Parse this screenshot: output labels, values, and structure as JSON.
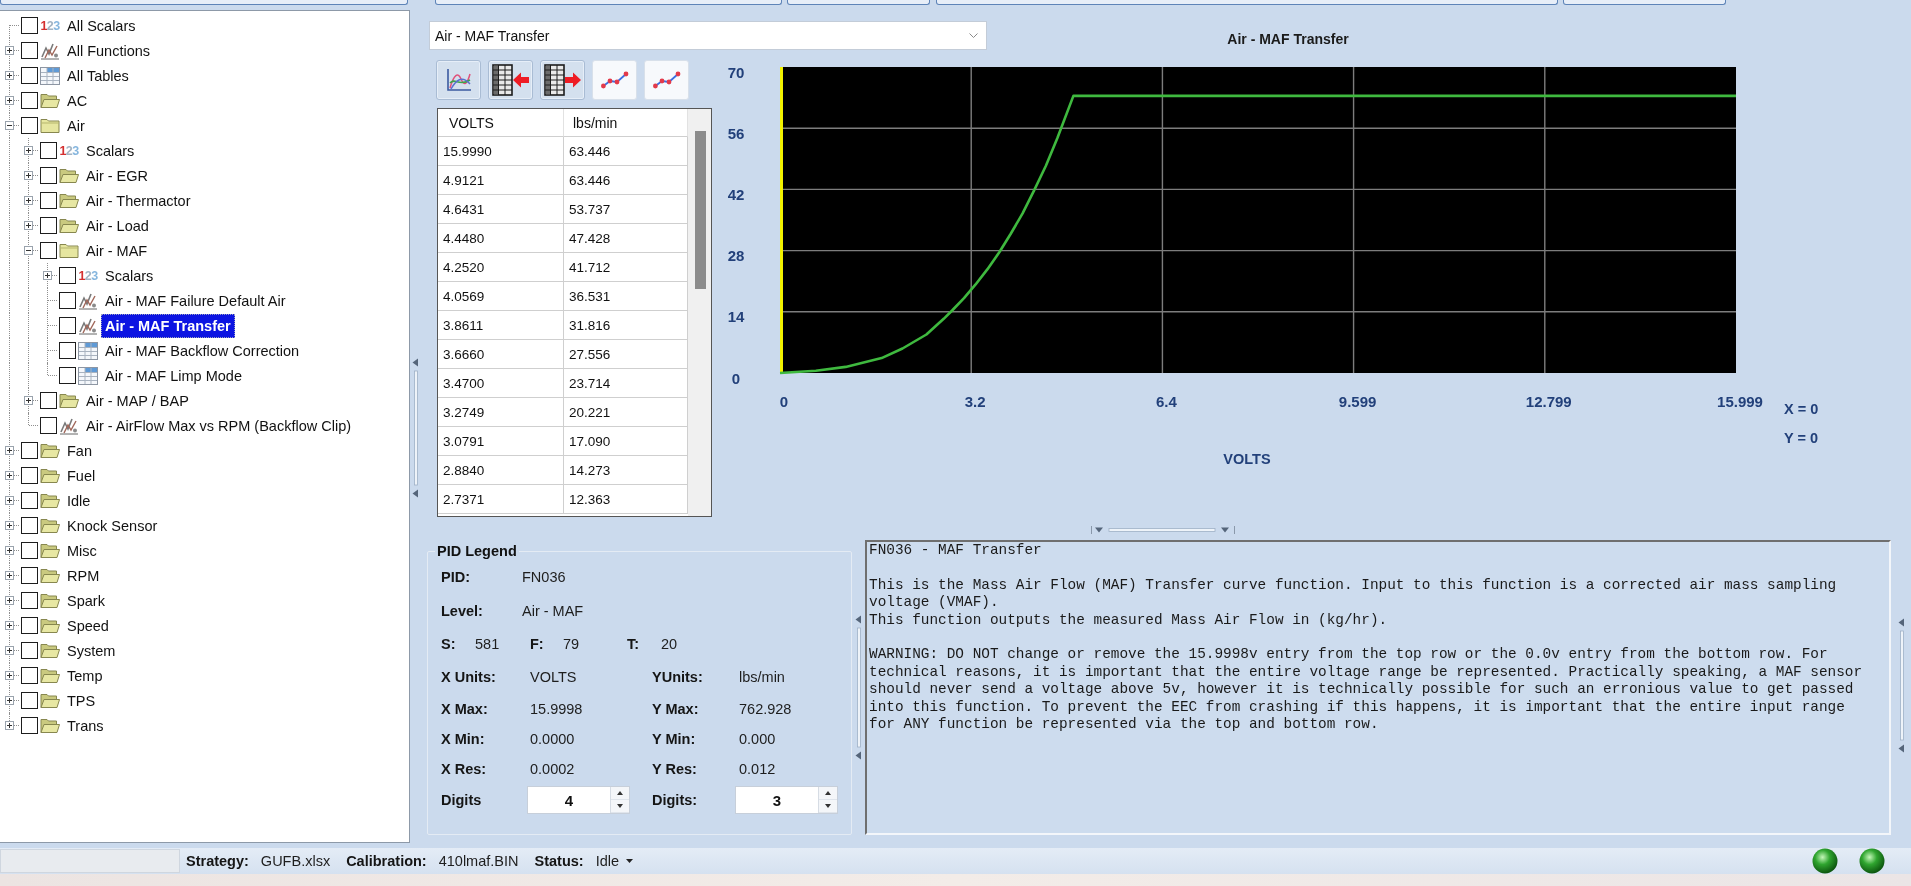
{
  "tree": [
    {
      "label": "All Scalars",
      "kind": "scalars",
      "icon_glyph": "123",
      "checked": false,
      "selected": false
    },
    {
      "label": "All Functions",
      "kind": "function",
      "checked": false,
      "selected": false,
      "expanded": false
    },
    {
      "label": "All Tables",
      "kind": "table",
      "checked": false,
      "selected": false,
      "expanded": false
    },
    {
      "label": "AC",
      "kind": "folder",
      "checked": false,
      "selected": false,
      "expanded": false
    },
    {
      "label": "Air",
      "kind": "folder",
      "checked": false,
      "selected": false,
      "expanded": true,
      "children": [
        {
          "label": "Scalars",
          "kind": "scalars",
          "icon_glyph": "123",
          "checked": false,
          "selected": false,
          "expanded": false
        },
        {
          "label": "Air - EGR",
          "kind": "folder",
          "checked": false,
          "selected": false,
          "expanded": false
        },
        {
          "label": "Air - Thermactor",
          "kind": "folder",
          "checked": false,
          "selected": false,
          "expanded": false
        },
        {
          "label": "Air - Load",
          "kind": "folder",
          "checked": false,
          "selected": false,
          "expanded": false
        },
        {
          "label": "Air - MAF",
          "kind": "folder",
          "checked": false,
          "selected": false,
          "expanded": true,
          "children": [
            {
              "label": "Scalars",
              "kind": "scalars",
              "icon_glyph": "123",
              "checked": false,
              "selected": false,
              "expanded": false
            },
            {
              "label": "Air - MAF Failure Default Air",
              "kind": "function",
              "checked": false,
              "selected": false
            },
            {
              "label": "Air - MAF Transfer",
              "kind": "function",
              "checked": false,
              "selected": true
            },
            {
              "label": "Air - MAF Backflow Correction",
              "kind": "table",
              "checked": false,
              "selected": false
            },
            {
              "label": "Air - MAF Limp Mode",
              "kind": "table",
              "checked": false,
              "selected": false
            }
          ]
        },
        {
          "label": "Air - MAP / BAP",
          "kind": "folder",
          "checked": false,
          "selected": false,
          "expanded": false
        },
        {
          "label": "Air - AirFlow Max vs RPM (Backflow Clip)",
          "kind": "function",
          "checked": false,
          "selected": false
        }
      ]
    },
    {
      "label": "Fan",
      "kind": "folder",
      "checked": false,
      "selected": false,
      "expanded": false
    },
    {
      "label": "Fuel",
      "kind": "folder",
      "checked": false,
      "selected": false,
      "expanded": false
    },
    {
      "label": "Idle",
      "kind": "folder",
      "checked": false,
      "selected": false,
      "expanded": false
    },
    {
      "label": "Knock Sensor",
      "kind": "folder",
      "checked": false,
      "selected": false,
      "expanded": false
    },
    {
      "label": "Misc",
      "kind": "folder",
      "checked": false,
      "selected": false,
      "expanded": false
    },
    {
      "label": "RPM",
      "kind": "folder",
      "checked": false,
      "selected": false,
      "expanded": false
    },
    {
      "label": "Spark",
      "kind": "folder",
      "checked": false,
      "selected": false,
      "expanded": false
    },
    {
      "label": "Speed",
      "kind": "folder",
      "checked": false,
      "selected": false,
      "expanded": false
    },
    {
      "label": "System",
      "kind": "folder",
      "checked": false,
      "selected": false,
      "expanded": false
    },
    {
      "label": "Temp",
      "kind": "folder",
      "checked": false,
      "selected": false,
      "expanded": false
    },
    {
      "label": "TPS",
      "kind": "folder",
      "checked": false,
      "selected": false,
      "expanded": false
    },
    {
      "label": "Trans",
      "kind": "folder",
      "checked": false,
      "selected": false,
      "expanded": false
    }
  ],
  "selector": {
    "value": "Air - MAF Transfer"
  },
  "toolbar": [
    {
      "kind": "chart",
      "pressed": true
    },
    {
      "kind": "table-left",
      "pressed": true
    },
    {
      "kind": "table-right",
      "pressed": true
    },
    {
      "kind": "points",
      "pressed": false
    },
    {
      "kind": "points",
      "pressed": false
    }
  ],
  "grid": {
    "columns": [
      "VOLTS",
      "lbs/min"
    ],
    "rows": [
      [
        "15.9990",
        "63.446"
      ],
      [
        "4.9121",
        "63.446"
      ],
      [
        "4.6431",
        "53.737"
      ],
      [
        "4.4480",
        "47.428"
      ],
      [
        "4.2520",
        "41.712"
      ],
      [
        "4.0569",
        "36.531"
      ],
      [
        "3.8611",
        "31.816"
      ],
      [
        "3.6660",
        "27.556"
      ],
      [
        "3.4700",
        "23.714"
      ],
      [
        "3.2749",
        "20.221"
      ],
      [
        "3.0791",
        "17.090"
      ],
      [
        "2.8840",
        "14.273"
      ],
      [
        "2.7371",
        "12.363"
      ]
    ]
  },
  "chart": {
    "chart_data": {
      "type": "line",
      "title": "Air - MAF Transfer",
      "xlabel": "VOLTS",
      "x": [
        0,
        0.6,
        1.1,
        1.7,
        2.05,
        2.45,
        2.74,
        2.88,
        3.08,
        3.27,
        3.47,
        3.67,
        3.86,
        4.06,
        4.25,
        4.45,
        4.64,
        4.91,
        15.999
      ],
      "series": [
        {
          "color": "#3fb93f",
          "values": [
            0,
            0.5,
            1.4,
            3.4,
            5.6,
            8.8,
            12.4,
            14.3,
            17.1,
            20.2,
            23.7,
            27.6,
            31.8,
            36.5,
            41.7,
            47.4,
            53.7,
            63.4,
            63.4
          ]
        }
      ],
      "xlim": [
        0,
        15.999
      ],
      "ylim": [
        0,
        70
      ],
      "xticks": [
        0,
        3.2,
        6.4,
        9.599,
        12.799,
        15.999
      ],
      "yticks": [
        0,
        14,
        28,
        42,
        56,
        70
      ],
      "grid": true
    },
    "readouts": [
      "X = 0",
      "Y = 0"
    ]
  },
  "pid_legend": {
    "title": "PID Legend",
    "info": [
      {
        "label": "PID:",
        "value": "FN036"
      },
      {
        "label": "Level:",
        "value": "Air - MAF"
      }
    ],
    "counts": [
      {
        "label": "S:",
        "value": "581"
      },
      {
        "label": "F:",
        "value": "79"
      },
      {
        "label": "T:",
        "value": "20"
      }
    ],
    "x_axis": [
      {
        "label": "X Units:",
        "value": "VOLTS"
      },
      {
        "label": "X Max:",
        "value": "15.9998"
      },
      {
        "label": "X Min:",
        "value": "0.0000"
      },
      {
        "label": "X Res:",
        "value": "0.0002"
      }
    ],
    "y_axis": [
      {
        "label": "YUnits:",
        "value": "lbs/min"
      },
      {
        "label": "Y Max:",
        "value": "762.928"
      },
      {
        "label": "Y Min:",
        "value": "0.000"
      },
      {
        "label": "Y Res:",
        "value": "0.012"
      }
    ],
    "digits": [
      {
        "label": "Digits",
        "value": "4"
      },
      {
        "label": "Digits:",
        "value": "3"
      }
    ]
  },
  "description": {
    "title": "FN036 - MAF Transfer",
    "sections": [
      [
        "This is the Mass Air Flow (MAF) Transfer curve function. Input to this function is a corrected air mass sampling voltage (VMAF).",
        "This function outputs the measured Mass Air Flow in (kg/hr)."
      ],
      [
        "WARNING: DO NOT change or remove the 15.9998v entry from the top row or the 0.0v entry from the bottom row. For technical reasons, it is important that the entire voltage range be represented. Practically speaking, a MAF sensor should never send a voltage above 5v, however it is technically possible for such an erronious value to get passed into this function. To prevent the EEC from crashing if this happens, it is important that the entire input range for ANY function be represented via the top and bottom row."
      ]
    ]
  },
  "status_bar": {
    "fields": [
      {
        "label": "Strategy:",
        "value": "GUFB.xlsx",
        "kind": "text"
      },
      {
        "label": "Calibration:",
        "value": "410lmaf.BIN",
        "kind": "text"
      },
      {
        "label": "Status:",
        "value": "Idle",
        "kind": "dropdown"
      }
    ],
    "indicators": [
      {
        "on": true
      },
      {
        "on": true
      }
    ]
  }
}
